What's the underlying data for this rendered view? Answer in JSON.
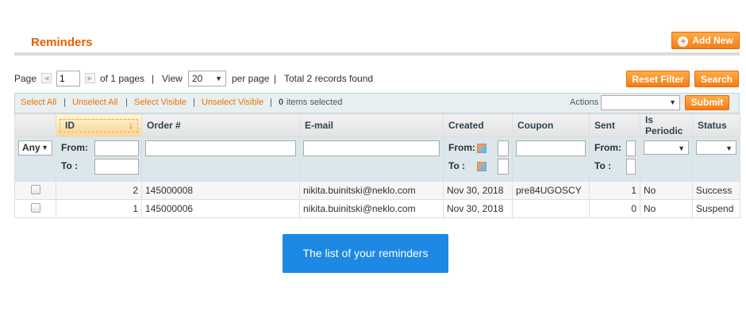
{
  "header": {
    "title": "Reminders",
    "add_new_label": "Add New"
  },
  "pager": {
    "page_label": "Page",
    "page_value": "1",
    "of_pages": "of 1 pages",
    "sep1": "|",
    "view_label": "View",
    "per_page_value": "20",
    "per_page_label": "per page",
    "sep2": "|",
    "total_records": "Total 2 records found",
    "reset_filter_label": "Reset Filter",
    "search_label": "Search"
  },
  "massaction": {
    "select_all": "Select All",
    "unselect_all": "Unselect All",
    "select_visible": "Select Visible",
    "unselect_visible": "Unselect Visible",
    "sep": "|",
    "selected_count": "0",
    "selected_label": "items selected",
    "actions_label": "Actions",
    "actions_value": "",
    "submit_label": "Submit"
  },
  "grid": {
    "columns": [
      "ID",
      "Order #",
      "E-mail",
      "Created",
      "Coupon",
      "Sent",
      "Is Periodic",
      "Status"
    ],
    "filter": {
      "any_label": "Any",
      "from_label": "From:",
      "to_label": "To :"
    },
    "rows": [
      {
        "id": "2",
        "order": "145000008",
        "email": "nikita.buinitski@neklo.com",
        "created": "Nov 30, 2018",
        "coupon": "pre84UGOSCY",
        "sent": "1",
        "periodic": "No",
        "status": "Success"
      },
      {
        "id": "1",
        "order": "145000006",
        "email": "nikita.buinitski@neklo.com",
        "created": "Nov 30, 2018",
        "coupon": "",
        "sent": "0",
        "periodic": "No",
        "status": "Suspend"
      }
    ]
  },
  "caption": {
    "label": "The list of your reminders"
  },
  "colors": {
    "accent": "#eb5e00",
    "button_orange": "#f77c16",
    "info_blue": "#1e88e5"
  },
  "icons": {
    "add": "plus-circle-icon",
    "sort": "sort-down-arrow-icon",
    "calendar": "calendar-icon",
    "prev": "arrow-left-icon",
    "next": "arrow-right-icon",
    "dropdown": "chevron-down-icon"
  }
}
